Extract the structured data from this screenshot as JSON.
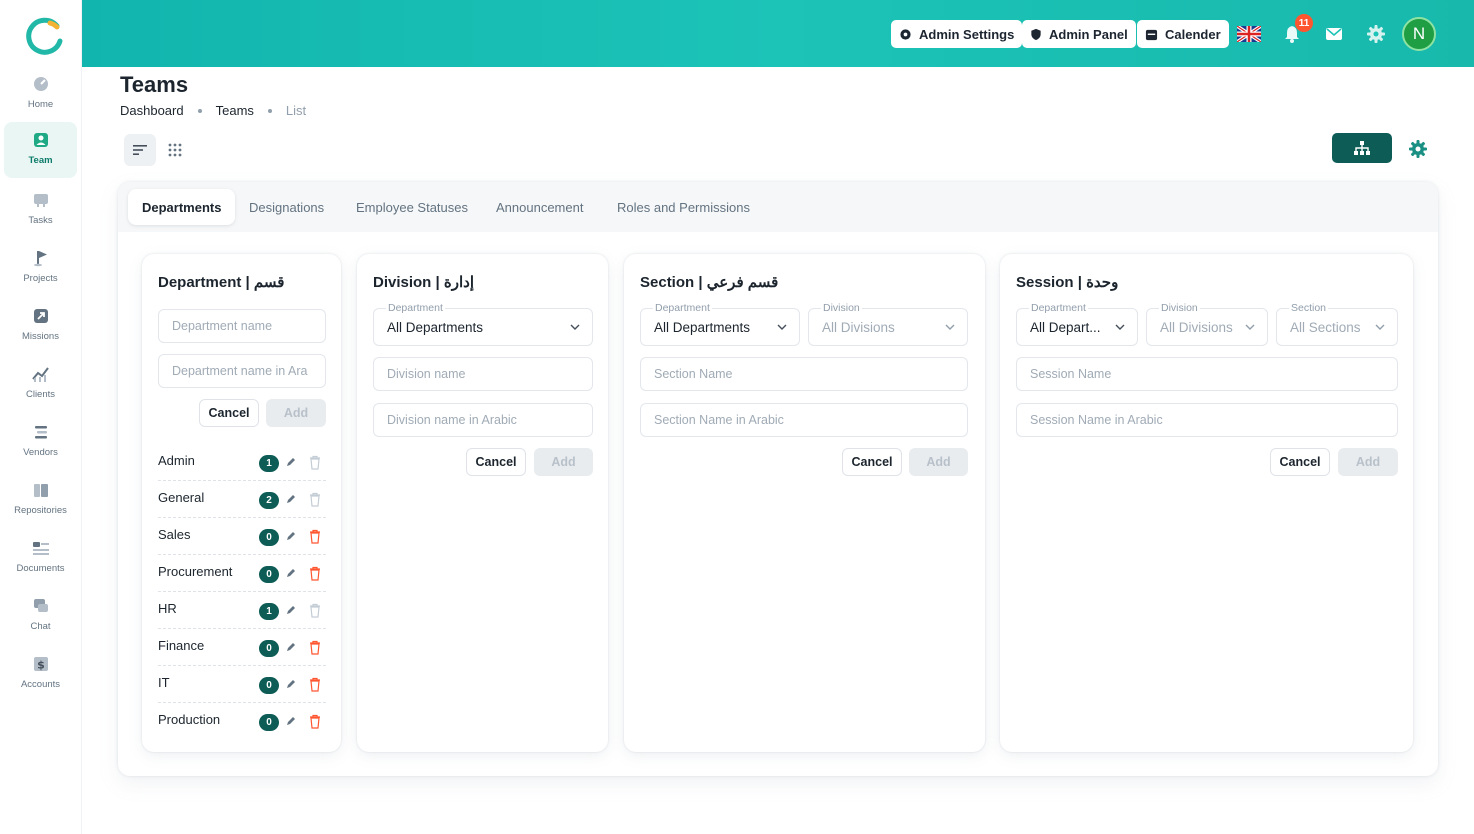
{
  "sidebar": {
    "items": [
      {
        "label": "Home",
        "icon": "home-icon"
      },
      {
        "label": "Team",
        "icon": "team-icon",
        "active": true
      },
      {
        "label": "Tasks",
        "icon": "tasks-icon"
      },
      {
        "label": "Projects",
        "icon": "projects-icon"
      },
      {
        "label": "Missions",
        "icon": "missions-icon"
      },
      {
        "label": "Clients",
        "icon": "clients-icon"
      },
      {
        "label": "Vendors",
        "icon": "vendors-icon"
      },
      {
        "label": "Repositories",
        "icon": "repositories-icon"
      },
      {
        "label": "Documents",
        "icon": "documents-icon"
      },
      {
        "label": "Chat",
        "icon": "chat-icon"
      },
      {
        "label": "Accounts",
        "icon": "accounts-icon"
      }
    ]
  },
  "header": {
    "admin_settings": "Admin Settings",
    "admin_panel": "Admin Panel",
    "calender": "Calender",
    "notification_count": "11",
    "avatar_initial": "N",
    "brand_color": "#1cc3b7"
  },
  "page": {
    "title": "Teams",
    "breadcrumb": [
      "Dashboard",
      "Teams",
      "List"
    ]
  },
  "tabs": [
    "Departments",
    "Designations",
    "Employee Statuses",
    "Announcement",
    "Roles and Permissions"
  ],
  "department_panel": {
    "title": "Department | قسم",
    "name_placeholder": "Department name",
    "arabic_placeholder": "Department name in Ara",
    "cancel": "Cancel",
    "add": "Add",
    "rows": [
      {
        "name": "Admin",
        "count": "1"
      },
      {
        "name": "General",
        "count": "2"
      },
      {
        "name": "Sales",
        "count": "0"
      },
      {
        "name": "Procurement",
        "count": "0"
      },
      {
        "name": "HR",
        "count": "1"
      },
      {
        "name": "Finance",
        "count": "0"
      },
      {
        "name": "IT",
        "count": "0"
      },
      {
        "name": "Production",
        "count": "0"
      }
    ]
  },
  "division_panel": {
    "title": "Division | إدارة",
    "department_label": "Department",
    "department_value": "All Departments",
    "name_placeholder": "Division name",
    "arabic_placeholder": "Division name in Arabic",
    "cancel": "Cancel",
    "add": "Add"
  },
  "section_panel": {
    "title": "Section | قسم فرعي",
    "department_label": "Department",
    "department_value": "All Departments",
    "division_label": "Division",
    "division_value": "All Divisions",
    "name_placeholder": "Section Name",
    "arabic_placeholder": "Section Name in Arabic",
    "cancel": "Cancel",
    "add": "Add"
  },
  "session_panel": {
    "title": "Session | وحدة",
    "department_label": "Department",
    "department_value": "All Depart...",
    "division_label": "Division",
    "division_value": "All Divisions",
    "section_label": "Section",
    "section_value": "All Sections",
    "name_placeholder": "Session Name",
    "arabic_placeholder": "Session Name in Arabic",
    "cancel": "Cancel",
    "add": "Add"
  }
}
